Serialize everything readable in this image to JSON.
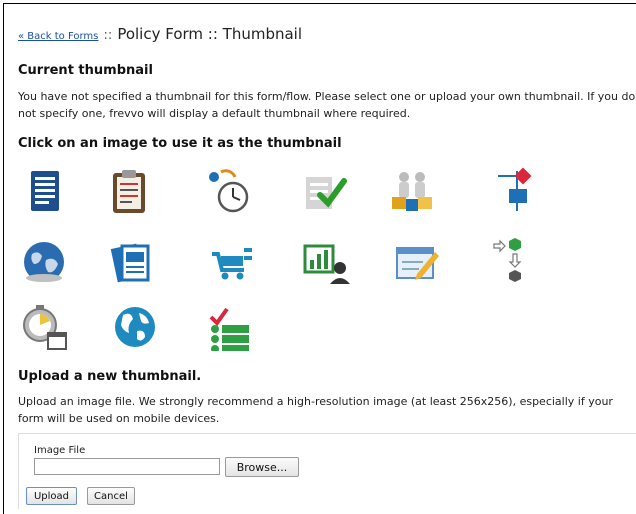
{
  "header": {
    "back_link": "« Back to Forms",
    "separator": "::",
    "title": "Policy Form :: Thumbnail"
  },
  "current_thumbnail": {
    "heading": "Current thumbnail",
    "text": "You have not specified a thumbnail for this form/flow. Please select one or upload your own thumbnail. If you do not specify one, frevvo will display a default thumbnail where required."
  },
  "gallery": {
    "heading": "Click on an image to use it as the thumbnail",
    "icons": [
      "document-list-icon",
      "clipboard-icon",
      "stopwatch-icon",
      "checklist-icon",
      "puzzle-people-icon",
      "flowchart-icon",
      "globe-icon",
      "documents-icon",
      "shopping-cart-icon",
      "chart-user-icon",
      "edit-form-icon",
      "workflow-icon",
      "timer-calendar-icon",
      "world-map-icon",
      "task-list-icon"
    ]
  },
  "upload": {
    "heading": "Upload a new thumbnail.",
    "text": "Upload an image file. We strongly recommend a high-resolution image (at least 256x256), especially if your form will be used on mobile devices.",
    "field_label": "Image File",
    "file_value": "",
    "browse_label": "Browse...",
    "upload_label": "Upload",
    "cancel_label": "Cancel"
  },
  "colors": {
    "link": "#1a4fa8",
    "accent_blue": "#1f6fb5",
    "accent_green": "#2ea043",
    "accent_red": "#d9283c"
  }
}
